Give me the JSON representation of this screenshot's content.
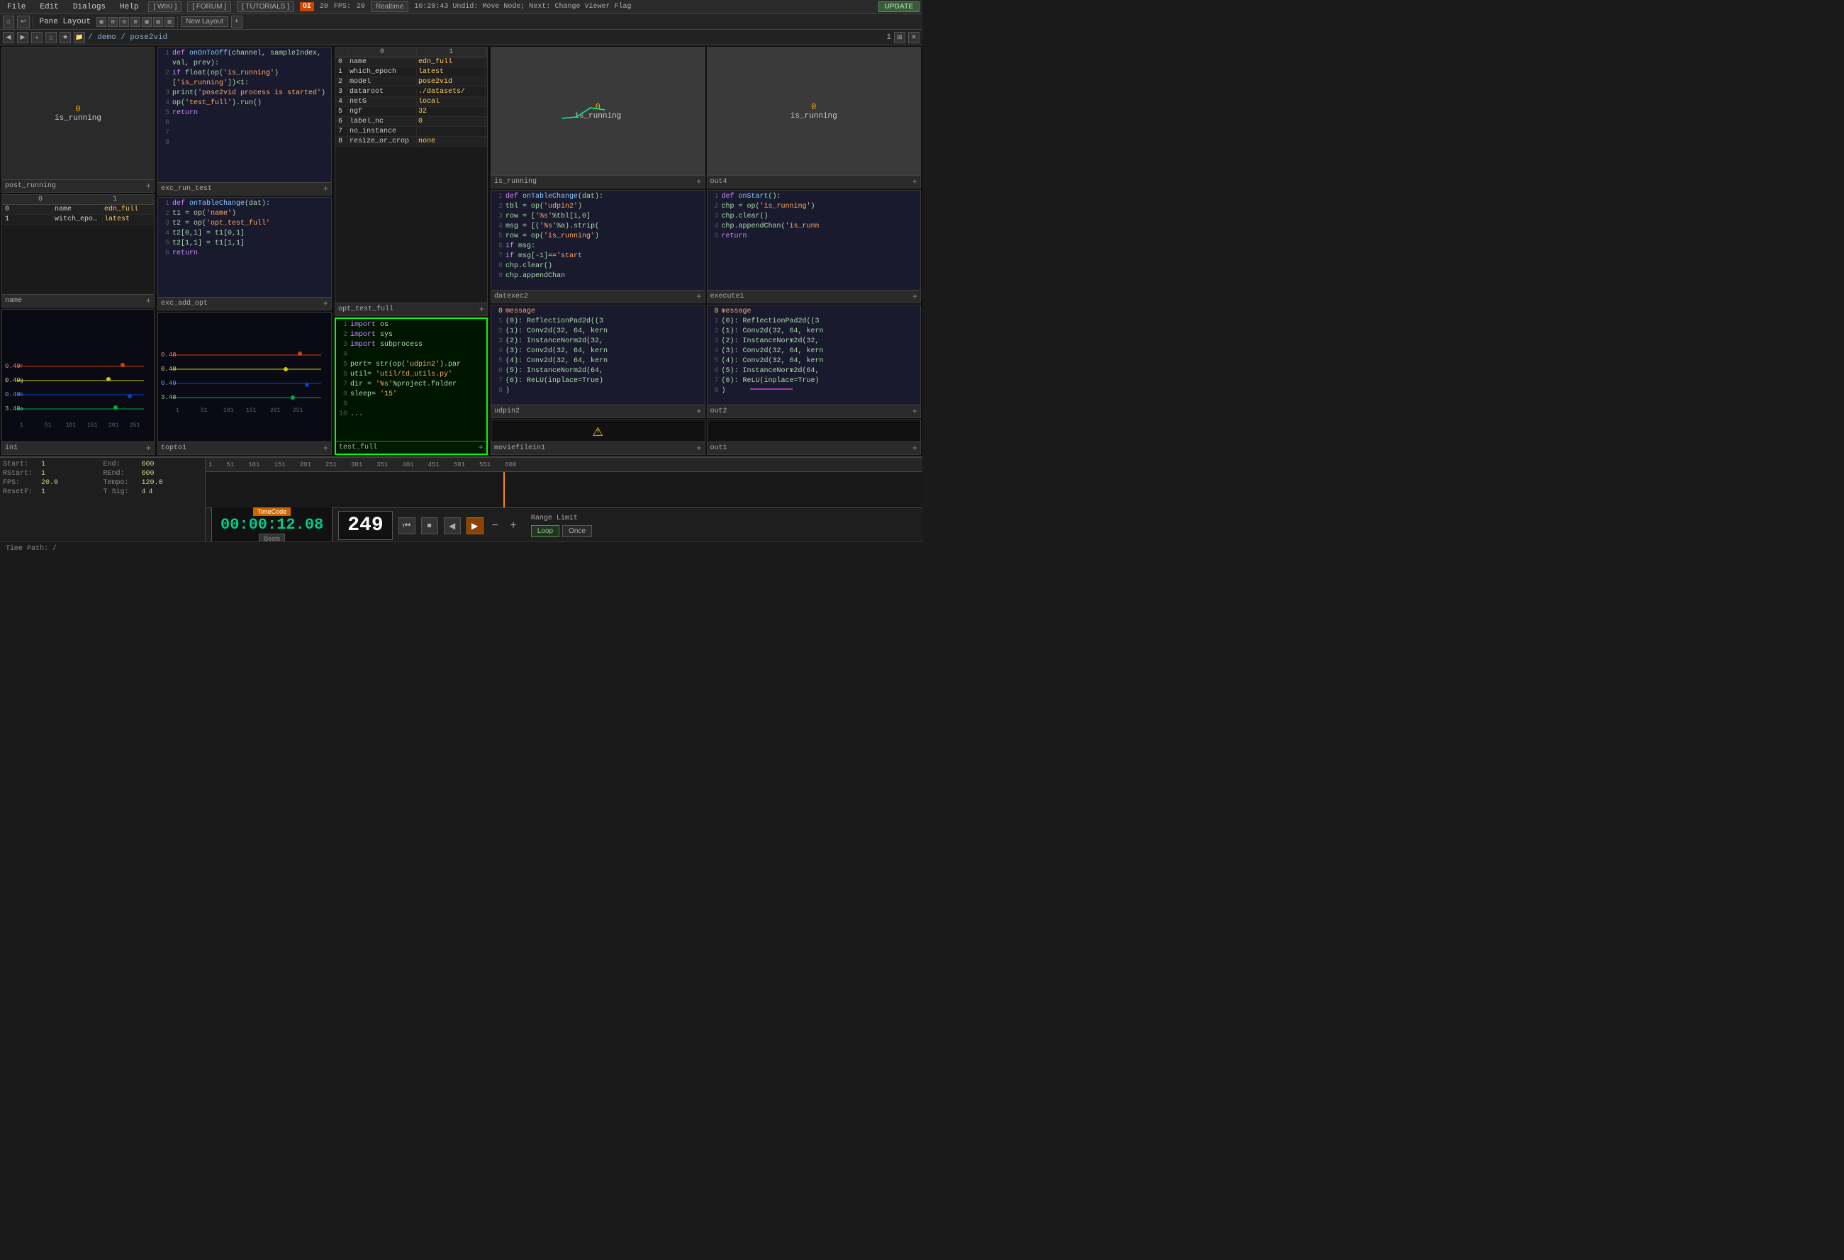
{
  "menubar": {
    "file": "File",
    "edit": "Edit",
    "dialogs": "Dialogs",
    "help": "Help",
    "wiki": "[ WIKI ]",
    "forum": "[ FORUM ]",
    "tutorials": "[ TUTORIALS ]",
    "oi_badge": "OI",
    "oi_num": "20",
    "fps_label": "FPS:",
    "fps_val": "20",
    "realtime": "Realtime",
    "status": "10:20:43 Undid: Move Node; Next: Change Viewer Flag",
    "update": "UPDATE"
  },
  "toolbar": {
    "pane_layout": "Pane Layout",
    "new_layout": "New Layout"
  },
  "pathbar": {
    "path": "/ demo / pose2vid",
    "num": "1"
  },
  "panels": {
    "post_running": {
      "label": "post_running",
      "value": "0",
      "subtext": "is_running"
    },
    "is_running_top": {
      "label": "is_running",
      "value": "0",
      "subtext": "is_running"
    },
    "out4": {
      "label": "out4",
      "value": "0",
      "subtext": "is_running"
    },
    "exc_run_test": {
      "label": "exc_run_test",
      "code": [
        {
          "num": "1",
          "text": "def onOnToOff(channel, sampleIndex, val, prev):"
        },
        {
          "num": "2",
          "text": "    if float(op('is_running')['is_running'])<1:"
        },
        {
          "num": "3",
          "text": "        print('pose2vid process is started')"
        },
        {
          "num": "4",
          "text": "        op('test_full').run()"
        },
        {
          "num": "5",
          "text": "    return"
        },
        {
          "num": "6",
          "text": ""
        },
        {
          "num": "7",
          "text": ""
        },
        {
          "num": "8",
          "text": ""
        }
      ]
    },
    "datexec2": {
      "label": "datexec2",
      "code": [
        {
          "num": "1",
          "text": "def onTableChange(dat):"
        },
        {
          "num": "2",
          "text": "    tbl = op('udpin2')"
        },
        {
          "num": "3",
          "text": "    row = ['%s'%tbl[i,0]"
        },
        {
          "num": "4",
          "text": "    msg = [('%s'%a).strip("
        },
        {
          "num": "5",
          "text": "    row = op('is_running')"
        },
        {
          "num": "6",
          "text": "    if msg:"
        },
        {
          "num": "7",
          "text": "        if msg[-1]=='start"
        },
        {
          "num": "8",
          "text": "            chp.clear()"
        },
        {
          "num": "9",
          "text": "            chp.appendChan"
        }
      ]
    },
    "execute1": {
      "label": "execute1",
      "code": [
        {
          "num": "1",
          "text": "def onStart():"
        },
        {
          "num": "2",
          "text": "    chp = op('is_running')"
        },
        {
          "num": "3",
          "text": "    chp.clear()"
        },
        {
          "num": "4",
          "text": "    chp.appendChan('is_runn"
        },
        {
          "num": "5",
          "text": "    return"
        }
      ]
    },
    "name": {
      "label": "name",
      "headers": [
        "0",
        "1"
      ],
      "rows": [
        {
          "idx": "0",
          "col0": "name",
          "col1": "edn_full"
        },
        {
          "idx": "1",
          "col0": "witch_epoch",
          "col1": "latest"
        }
      ]
    },
    "exc_add_opt": {
      "label": "exc_add_opt",
      "code": [
        {
          "num": "1",
          "text": "def onTableChange(dat):"
        },
        {
          "num": "2",
          "text": "    t1 = op('name')"
        },
        {
          "num": "3",
          "text": "    t2 = op('opt_test_full'"
        },
        {
          "num": "4",
          "text": "    t2[0,1] = t1[0,1]"
        },
        {
          "num": "5",
          "text": "    t2[1,1] = t1[1,1]"
        },
        {
          "num": "6",
          "text": "    return"
        }
      ]
    },
    "opt_test_full": {
      "label": "opt_test_full",
      "headers": [
        "0",
        "1"
      ],
      "rows": [
        {
          "idx": "0",
          "col0": "name",
          "col1": "edn_full"
        },
        {
          "idx": "1",
          "col0": "which_epoch",
          "col1": "latest"
        },
        {
          "idx": "2",
          "col0": "model",
          "col1": "pose2vid"
        },
        {
          "idx": "3",
          "col0": "dataroot",
          "col1": "./datasets/"
        },
        {
          "idx": "4",
          "col0": "netG",
          "col1": "local"
        },
        {
          "idx": "5",
          "col0": "ngf",
          "col1": "32"
        },
        {
          "idx": "6",
          "col0": "label_nc",
          "col1": "0"
        },
        {
          "idx": "7",
          "col0": "no_instance",
          "col1": ""
        },
        {
          "idx": "8",
          "col0": "resize_or_crop_none",
          "col1": ""
        }
      ]
    },
    "udpin2": {
      "label": "udpin2",
      "code_rows": [
        {
          "num": "0",
          "text": "message"
        },
        {
          "num": "1",
          "text": "    (0): ReflectionPad2d((3"
        },
        {
          "num": "2",
          "text": "    (1): Conv2d(32, 64, kern"
        },
        {
          "num": "3",
          "text": "    (2): InstanceNorm2d(32,"
        },
        {
          "num": "4",
          "text": "    (3): Conv2d(32, 64, kern"
        },
        {
          "num": "5",
          "text": "    (4): Conv2d(32, 64, kern"
        },
        {
          "num": "6",
          "text": "    (5): InstanceNorm2d(64,"
        },
        {
          "num": "7",
          "text": "    (6): ReLU(inplace=True)"
        },
        {
          "num": "8",
          "text": "  )"
        }
      ]
    },
    "out2": {
      "label": "out2",
      "code_rows": [
        {
          "num": "0",
          "text": "message"
        },
        {
          "num": "1",
          "text": "    (0): ReflectionPad2d((3"
        },
        {
          "num": "2",
          "text": "    (1): Conv2d(32, 64, kern"
        },
        {
          "num": "3",
          "text": "    (2): InstanceNorm2d(32,"
        },
        {
          "num": "4",
          "text": "    (3): Conv2d(32, 64, kern"
        },
        {
          "num": "5",
          "text": "    (4): Conv2d(32, 64, kern"
        },
        {
          "num": "6",
          "text": "    (5): InstanceNorm2d(64,"
        },
        {
          "num": "7",
          "text": "    (6): ReLU(inplace=True)"
        },
        {
          "num": "8",
          "text": "  )"
        }
      ]
    },
    "test_full": {
      "label": "test_full",
      "code": [
        {
          "num": "1",
          "text": "import os"
        },
        {
          "num": "2",
          "text": "import sys"
        },
        {
          "num": "3",
          "text": "import subprocess"
        },
        {
          "num": "4",
          "text": ""
        },
        {
          "num": "5",
          "text": "port= str(op('udpin2').par"
        },
        {
          "num": "6",
          "text": "util= 'util/td_utils.py'"
        },
        {
          "num": "7",
          "text": "dir = '%s'%project.folder"
        },
        {
          "num": "8",
          "text": "sleep= '15'"
        },
        {
          "num": "9",
          "text": ""
        },
        {
          "num": "10",
          "text": "..."
        }
      ]
    },
    "topto1": {
      "label": "topto1"
    },
    "in1": {
      "label": "in1"
    },
    "moviefilein1": {
      "label": "moviefilein1"
    },
    "out1": {
      "label": "out1"
    }
  },
  "timeline": {
    "start_label": "Start:",
    "start_val": "1",
    "end_label": "End:",
    "end_val": "600",
    "rstart_label": "RStart:",
    "rstart_val": "1",
    "rend_label": "REnd:",
    "rend_val": "600",
    "fps_label": "FPS:",
    "fps_val": "20.0",
    "tempo_label": "Tempo:",
    "tempo_val": "120.0",
    "resetf_label": "ResetF:",
    "resetf_val": "1",
    "tsig_label": "T Sig:",
    "tsig_val": "4",
    "tsig_val2": "4",
    "timecode": "00:00:12.08",
    "frame": "249",
    "rulers": [
      "1",
      "51",
      "101",
      "151",
      "201",
      "251",
      "301",
      "351",
      "401",
      "451",
      "501",
      "551",
      "600"
    ],
    "range_limit": "Range Limit",
    "loop_btn": "Loop",
    "once_btn": "Once",
    "status": "Time Path: /",
    "timecode_label": "TimeCode",
    "beats_label": "Beats"
  }
}
